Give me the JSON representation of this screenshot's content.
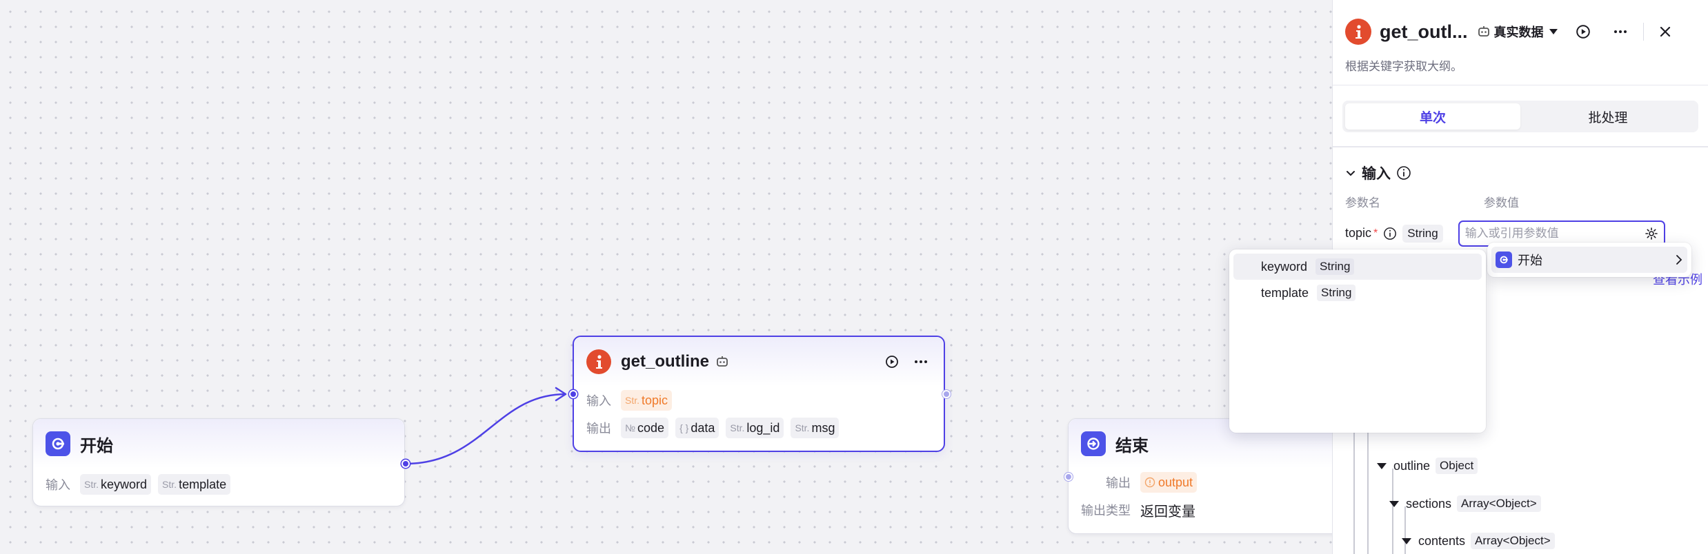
{
  "start_node": {
    "title": "开始",
    "input_label": "输入",
    "inputs": [
      {
        "type": "Str.",
        "name": "keyword"
      },
      {
        "type": "Str.",
        "name": "template"
      }
    ]
  },
  "plugin_node": {
    "title": "get_outline",
    "input_label": "输入",
    "output_label": "输出",
    "inputs": [
      {
        "type": "Str.",
        "name": "topic"
      }
    ],
    "outputs": [
      {
        "type": "№",
        "name": "code"
      },
      {
        "type": "{ }",
        "name": "data"
      },
      {
        "type": "Str.",
        "name": "log_id"
      },
      {
        "type": "Str.",
        "name": "msg"
      }
    ]
  },
  "end_node": {
    "title": "结束",
    "output_label": "输出",
    "output_chip": "output",
    "output_type_label": "输出类型",
    "output_type_value": "返回变量"
  },
  "panel": {
    "title": "get_outl...",
    "mode": "真实数据",
    "description": "根据关键字获取大纲。",
    "tabs": [
      "单次",
      "批处理"
    ],
    "active_tab": 0,
    "section_title": "输入",
    "col_name": "参数名",
    "col_value": "参数值",
    "param": {
      "name": "topic",
      "required_mark": "*",
      "type": "String",
      "placeholder": "输入或引用参数值"
    },
    "example_link": "查看示例",
    "tree": [
      {
        "name": "outline",
        "type": "Object"
      },
      {
        "name": "sections",
        "type": "Array<Object>"
      },
      {
        "name": "contents",
        "type": "Array<Object>"
      }
    ]
  },
  "ref_dropdown": {
    "node_label": "开始"
  },
  "var_dropdown": {
    "items": [
      {
        "name": "keyword",
        "type": "String"
      },
      {
        "name": "template",
        "type": "String"
      }
    ]
  },
  "colors": {
    "accent": "#4e40e5",
    "start_icon": "#4d53e8",
    "plugin_icon": "#e24b2e",
    "warning": "#f07a2a"
  }
}
